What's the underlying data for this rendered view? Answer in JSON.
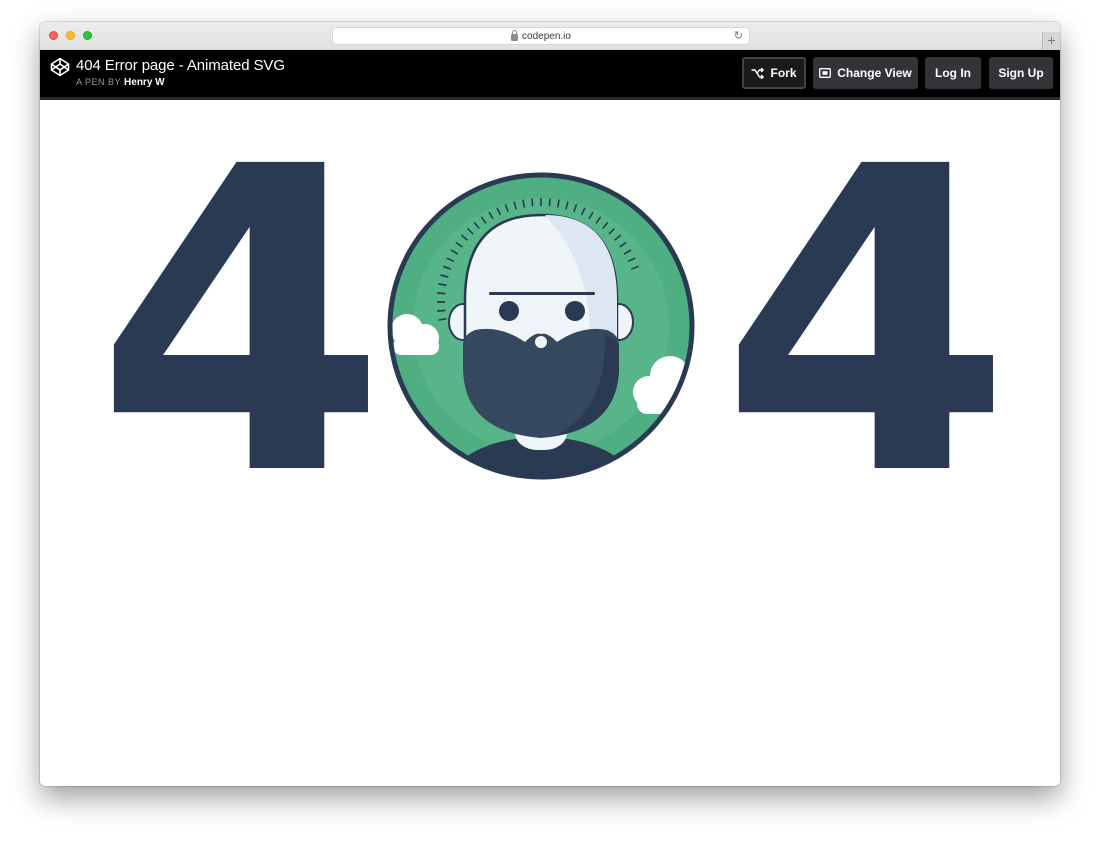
{
  "browser": {
    "url": "codepen.io",
    "new_tab_label": "+"
  },
  "header": {
    "title": "404 Error page - Animated SVG",
    "byline_prefix": "A PEN BY",
    "author": "Henry W"
  },
  "actions": {
    "fork": "Fork",
    "change_view": "Change View",
    "login": "Log In",
    "signup": "Sign Up"
  },
  "content": {
    "digit_left": "4",
    "digit_right": "4"
  },
  "colors": {
    "digit": "#293a52",
    "avatar_bg": "#4fae82",
    "header_bg": "#000000",
    "button_bg": "#333438"
  },
  "icons": [
    "codepen-logo-icon",
    "lock-icon",
    "reload-icon",
    "fork-icon",
    "change-view-icon"
  ]
}
